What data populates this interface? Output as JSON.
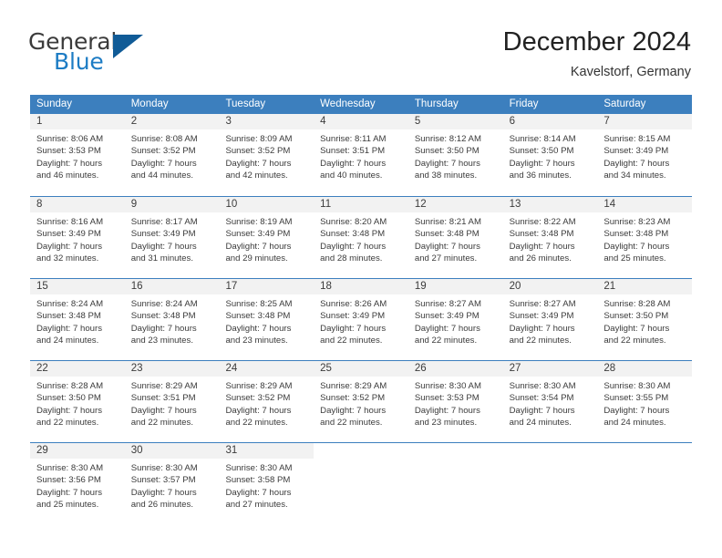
{
  "brand": {
    "name_part1": "General",
    "name_part2": "Blue",
    "triangle_icon": "blue-triangle-icon",
    "colors": {
      "general_text": "#3b3b3b",
      "blue_text": "#1d7cc4",
      "triangle": "#105b97"
    }
  },
  "header": {
    "title": "December 2024",
    "subtitle": "Kavelstorf, Germany"
  },
  "calendar": {
    "accent_color": "#3c7fbe",
    "day_number_bg": "#f2f2f2",
    "weekdays": [
      "Sunday",
      "Monday",
      "Tuesday",
      "Wednesday",
      "Thursday",
      "Friday",
      "Saturday"
    ],
    "weeks": [
      [
        {
          "day": "1",
          "sunrise": "Sunrise: 8:06 AM",
          "sunset": "Sunset: 3:53 PM",
          "daylight_line1": "Daylight: 7 hours",
          "daylight_line2": "and 46 minutes."
        },
        {
          "day": "2",
          "sunrise": "Sunrise: 8:08 AM",
          "sunset": "Sunset: 3:52 PM",
          "daylight_line1": "Daylight: 7 hours",
          "daylight_line2": "and 44 minutes."
        },
        {
          "day": "3",
          "sunrise": "Sunrise: 8:09 AM",
          "sunset": "Sunset: 3:52 PM",
          "daylight_line1": "Daylight: 7 hours",
          "daylight_line2": "and 42 minutes."
        },
        {
          "day": "4",
          "sunrise": "Sunrise: 8:11 AM",
          "sunset": "Sunset: 3:51 PM",
          "daylight_line1": "Daylight: 7 hours",
          "daylight_line2": "and 40 minutes."
        },
        {
          "day": "5",
          "sunrise": "Sunrise: 8:12 AM",
          "sunset": "Sunset: 3:50 PM",
          "daylight_line1": "Daylight: 7 hours",
          "daylight_line2": "and 38 minutes."
        },
        {
          "day": "6",
          "sunrise": "Sunrise: 8:14 AM",
          "sunset": "Sunset: 3:50 PM",
          "daylight_line1": "Daylight: 7 hours",
          "daylight_line2": "and 36 minutes."
        },
        {
          "day": "7",
          "sunrise": "Sunrise: 8:15 AM",
          "sunset": "Sunset: 3:49 PM",
          "daylight_line1": "Daylight: 7 hours",
          "daylight_line2": "and 34 minutes."
        }
      ],
      [
        {
          "day": "8",
          "sunrise": "Sunrise: 8:16 AM",
          "sunset": "Sunset: 3:49 PM",
          "daylight_line1": "Daylight: 7 hours",
          "daylight_line2": "and 32 minutes."
        },
        {
          "day": "9",
          "sunrise": "Sunrise: 8:17 AM",
          "sunset": "Sunset: 3:49 PM",
          "daylight_line1": "Daylight: 7 hours",
          "daylight_line2": "and 31 minutes."
        },
        {
          "day": "10",
          "sunrise": "Sunrise: 8:19 AM",
          "sunset": "Sunset: 3:49 PM",
          "daylight_line1": "Daylight: 7 hours",
          "daylight_line2": "and 29 minutes."
        },
        {
          "day": "11",
          "sunrise": "Sunrise: 8:20 AM",
          "sunset": "Sunset: 3:48 PM",
          "daylight_line1": "Daylight: 7 hours",
          "daylight_line2": "and 28 minutes."
        },
        {
          "day": "12",
          "sunrise": "Sunrise: 8:21 AM",
          "sunset": "Sunset: 3:48 PM",
          "daylight_line1": "Daylight: 7 hours",
          "daylight_line2": "and 27 minutes."
        },
        {
          "day": "13",
          "sunrise": "Sunrise: 8:22 AM",
          "sunset": "Sunset: 3:48 PM",
          "daylight_line1": "Daylight: 7 hours",
          "daylight_line2": "and 26 minutes."
        },
        {
          "day": "14",
          "sunrise": "Sunrise: 8:23 AM",
          "sunset": "Sunset: 3:48 PM",
          "daylight_line1": "Daylight: 7 hours",
          "daylight_line2": "and 25 minutes."
        }
      ],
      [
        {
          "day": "15",
          "sunrise": "Sunrise: 8:24 AM",
          "sunset": "Sunset: 3:48 PM",
          "daylight_line1": "Daylight: 7 hours",
          "daylight_line2": "and 24 minutes."
        },
        {
          "day": "16",
          "sunrise": "Sunrise: 8:24 AM",
          "sunset": "Sunset: 3:48 PM",
          "daylight_line1": "Daylight: 7 hours",
          "daylight_line2": "and 23 minutes."
        },
        {
          "day": "17",
          "sunrise": "Sunrise: 8:25 AM",
          "sunset": "Sunset: 3:48 PM",
          "daylight_line1": "Daylight: 7 hours",
          "daylight_line2": "and 23 minutes."
        },
        {
          "day": "18",
          "sunrise": "Sunrise: 8:26 AM",
          "sunset": "Sunset: 3:49 PM",
          "daylight_line1": "Daylight: 7 hours",
          "daylight_line2": "and 22 minutes."
        },
        {
          "day": "19",
          "sunrise": "Sunrise: 8:27 AM",
          "sunset": "Sunset: 3:49 PM",
          "daylight_line1": "Daylight: 7 hours",
          "daylight_line2": "and 22 minutes."
        },
        {
          "day": "20",
          "sunrise": "Sunrise: 8:27 AM",
          "sunset": "Sunset: 3:49 PM",
          "daylight_line1": "Daylight: 7 hours",
          "daylight_line2": "and 22 minutes."
        },
        {
          "day": "21",
          "sunrise": "Sunrise: 8:28 AM",
          "sunset": "Sunset: 3:50 PM",
          "daylight_line1": "Daylight: 7 hours",
          "daylight_line2": "and 22 minutes."
        }
      ],
      [
        {
          "day": "22",
          "sunrise": "Sunrise: 8:28 AM",
          "sunset": "Sunset: 3:50 PM",
          "daylight_line1": "Daylight: 7 hours",
          "daylight_line2": "and 22 minutes."
        },
        {
          "day": "23",
          "sunrise": "Sunrise: 8:29 AM",
          "sunset": "Sunset: 3:51 PM",
          "daylight_line1": "Daylight: 7 hours",
          "daylight_line2": "and 22 minutes."
        },
        {
          "day": "24",
          "sunrise": "Sunrise: 8:29 AM",
          "sunset": "Sunset: 3:52 PM",
          "daylight_line1": "Daylight: 7 hours",
          "daylight_line2": "and 22 minutes."
        },
        {
          "day": "25",
          "sunrise": "Sunrise: 8:29 AM",
          "sunset": "Sunset: 3:52 PM",
          "daylight_line1": "Daylight: 7 hours",
          "daylight_line2": "and 22 minutes."
        },
        {
          "day": "26",
          "sunrise": "Sunrise: 8:30 AM",
          "sunset": "Sunset: 3:53 PM",
          "daylight_line1": "Daylight: 7 hours",
          "daylight_line2": "and 23 minutes."
        },
        {
          "day": "27",
          "sunrise": "Sunrise: 8:30 AM",
          "sunset": "Sunset: 3:54 PM",
          "daylight_line1": "Daylight: 7 hours",
          "daylight_line2": "and 24 minutes."
        },
        {
          "day": "28",
          "sunrise": "Sunrise: 8:30 AM",
          "sunset": "Sunset: 3:55 PM",
          "daylight_line1": "Daylight: 7 hours",
          "daylight_line2": "and 24 minutes."
        }
      ],
      [
        {
          "day": "29",
          "sunrise": "Sunrise: 8:30 AM",
          "sunset": "Sunset: 3:56 PM",
          "daylight_line1": "Daylight: 7 hours",
          "daylight_line2": "and 25 minutes."
        },
        {
          "day": "30",
          "sunrise": "Sunrise: 8:30 AM",
          "sunset": "Sunset: 3:57 PM",
          "daylight_line1": "Daylight: 7 hours",
          "daylight_line2": "and 26 minutes."
        },
        {
          "day": "31",
          "sunrise": "Sunrise: 8:30 AM",
          "sunset": "Sunset: 3:58 PM",
          "daylight_line1": "Daylight: 7 hours",
          "daylight_line2": "and 27 minutes."
        },
        {
          "day": "",
          "sunrise": "",
          "sunset": "",
          "daylight_line1": "",
          "daylight_line2": ""
        },
        {
          "day": "",
          "sunrise": "",
          "sunset": "",
          "daylight_line1": "",
          "daylight_line2": ""
        },
        {
          "day": "",
          "sunrise": "",
          "sunset": "",
          "daylight_line1": "",
          "daylight_line2": ""
        },
        {
          "day": "",
          "sunrise": "",
          "sunset": "",
          "daylight_line1": "",
          "daylight_line2": ""
        }
      ]
    ]
  }
}
